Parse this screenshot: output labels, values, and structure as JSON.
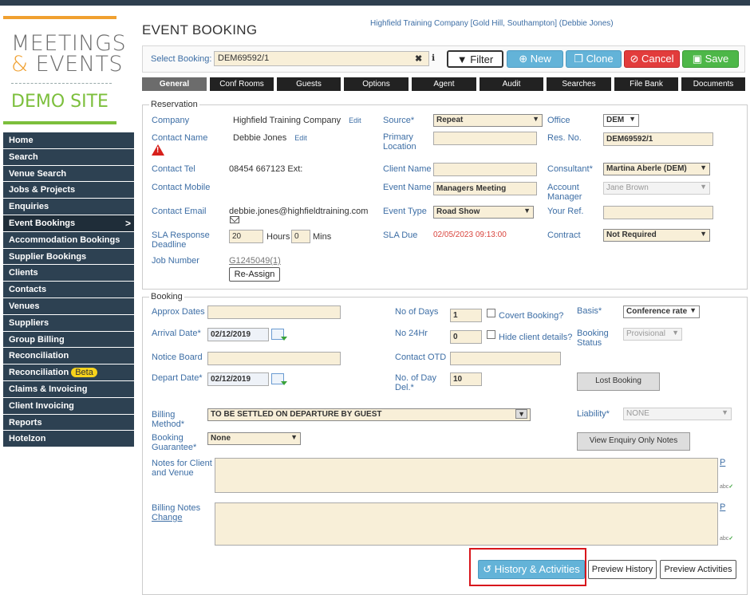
{
  "sidebar": {
    "brand_line1": "MEETINGS",
    "brand_amp": "&",
    "brand_line2": "EVENTS",
    "brand_demo": "DEMO SITE",
    "items": [
      {
        "label": "Home"
      },
      {
        "label": "Search"
      },
      {
        "label": "Venue Search"
      },
      {
        "label": "Jobs & Projects"
      },
      {
        "label": "Enquiries"
      },
      {
        "label": "Event Bookings"
      },
      {
        "label": "Accommodation Bookings"
      },
      {
        "label": "Supplier Bookings"
      },
      {
        "label": "Clients"
      },
      {
        "label": "Contacts"
      },
      {
        "label": "Venues"
      },
      {
        "label": "Suppliers"
      },
      {
        "label": "Group Billing"
      },
      {
        "label": "Reconciliation"
      },
      {
        "label": "Reconciliation",
        "badge": "Beta"
      },
      {
        "label": "Claims & Invoicing"
      },
      {
        "label": "Client Invoicing"
      },
      {
        "label": "Reports"
      },
      {
        "label": "Hotelzon"
      }
    ],
    "active_chevron": ">"
  },
  "header": {
    "title": "EVENT BOOKING",
    "company": "Highfield Training Company [Gold Hill, Southampton] (Debbie Jones)"
  },
  "booking_bar": {
    "label": "Select Booking:",
    "value": "DEM69592/1",
    "clear": "✖",
    "info": "ℹ",
    "filter": "Filter",
    "new": "New",
    "clone": "Clone",
    "cancel": "Cancel",
    "save": "Save"
  },
  "tabs": [
    "General",
    "Conf Rooms",
    "Guests",
    "Options",
    "Agent",
    "Audit",
    "Searches",
    "File Bank",
    "Documents"
  ],
  "reservation": {
    "legend": "Reservation",
    "company_label": "Company",
    "company_value": "Highfield Training Company",
    "edit": "Edit",
    "contact_name_label": "Contact Name",
    "contact_name_value": "Debbie Jones",
    "contact_tel_label": "Contact Tel",
    "contact_tel_value": "08454 667123 Ext:",
    "contact_mobile_label": "Contact Mobile",
    "contact_email_label": "Contact Email",
    "contact_email_value": "debbie.jones@highfieldtraining.com",
    "sla_label": "SLA Response Deadline",
    "sla_hours": "20",
    "hours_label": "Hours",
    "sla_mins": "0",
    "mins_label": "Mins",
    "job_number_label": "Job Number",
    "job_number_value": "G1245049(1)",
    "reassign": "Re-Assign",
    "source_label": "Source*",
    "source_value": "Repeat",
    "primary_location_label": "Primary Location",
    "client_name_label": "Client Name",
    "event_name_label": "Event Name",
    "event_name_value": "Managers Meeting",
    "event_type_label": "Event Type",
    "event_type_value": "Road Show",
    "sla_due_label": "SLA Due",
    "sla_due_value": "02/05/2023 09:13:00",
    "office_label": "Office",
    "office_value": "DEM",
    "res_no_label": "Res. No.",
    "res_no_value": "DEM69592/1",
    "consultant_label": "Consultant*",
    "consultant_value": "Martina Aberle (DEM)",
    "account_manager_label": "Account Manager",
    "account_manager_value": "Jane Brown",
    "your_ref_label": "Your Ref.",
    "contract_label": "Contract",
    "contract_value": "Not Required"
  },
  "booking": {
    "legend": "Booking",
    "approx_dates_label": "Approx Dates",
    "arrival_label": "Arrival Date*",
    "arrival_value": "02/12/2019",
    "notice_board_label": "Notice Board",
    "depart_label": "Depart Date*",
    "depart_value": "02/12/2019",
    "no_days_label": "No of Days",
    "no_days_value": "1",
    "covert_label": "Covert Booking?",
    "no24_label": "No 24Hr",
    "no24_value": "0",
    "hide_client_label": "Hide client details?",
    "contact_otd_label": "Contact OTD",
    "day_del_label": "No. of Day Del.*",
    "day_del_value": "10",
    "basis_label": "Basis*",
    "basis_value": "Conference rate",
    "booking_status_label": "Booking Status",
    "booking_status_value": "Provisional",
    "lost_booking": "Lost Booking",
    "billing_method_label": "Billing Method*",
    "billing_method_value": "TO BE SETTLED ON DEPARTURE BY GUEST",
    "liability_label": "Liability*",
    "liability_value": "NONE",
    "guarantee_label": "Booking Guarantee*",
    "guarantee_value": "None",
    "view_enquiry": "View Enquiry Only Notes",
    "notes_label": "Notes for Client and Venue",
    "billing_notes_label": "Billing Notes",
    "change_label": "Change",
    "p_link": "P",
    "abc": "abc"
  },
  "footer": {
    "history": "History & Activities",
    "preview_history": "Preview History",
    "preview_activities": "Preview Activities"
  },
  "colors": {
    "sidebar_bg": "#2d4152",
    "accent_orange": "#f0a030",
    "accent_green": "#7cbf3c",
    "link_blue": "#3d6ea5",
    "highlight_red": "#d8161c"
  }
}
